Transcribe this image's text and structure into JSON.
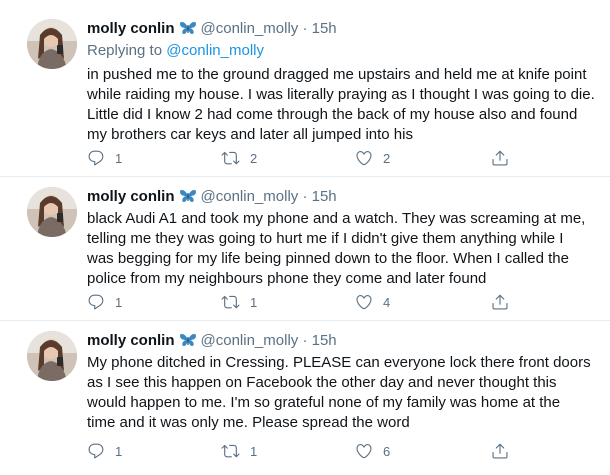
{
  "tweets": [
    {
      "name": "molly conlin",
      "handle": "@conlin_molly",
      "dot": "·",
      "time": "15h",
      "replying_prefix": "Replying to ",
      "replying_handle": "@conlin_molly",
      "lines": [
        "in pushed me to the ground dragged me upstairs and held me at knife point",
        "while raiding my house. I was literally praying as I thought I was going to die.",
        "Little did I know 2 had come through the back of my house also and found",
        "my brothers car keys and later all jumped into his"
      ],
      "reply_count": "1",
      "retweet_count": "2",
      "like_count": "2"
    },
    {
      "name": "molly conlin",
      "handle": "@conlin_molly",
      "dot": "·",
      "time": "15h",
      "lines": [
        "black Audi A1 and took my phone and a watch. They was screaming at me,",
        "telling me they was going to hurt me if I didn't give them anything while I",
        "was begging for my life being pinned down to the floor. When I called the",
        "police from my neighbours phone they come and later found"
      ],
      "reply_count": "1",
      "retweet_count": "1",
      "like_count": "4"
    },
    {
      "name": "molly conlin",
      "handle": "@conlin_molly",
      "dot": "·",
      "time": "15h",
      "lines": [
        "My phone ditched in Cressing. PLEASE can everyone lock there front doors",
        "as I see this happen on Facebook the other day and never thought this",
        "would happen to me. I'm so grateful none of my family was home at the",
        "time and it was only me. Please spread the word"
      ],
      "reply_count": "1",
      "retweet_count": "1",
      "like_count": "6"
    }
  ],
  "icons": {
    "verified_emoji": "butterfly-icon",
    "reply": "reply-icon",
    "retweet": "retweet-icon",
    "like": "heart-icon",
    "share": "share-icon"
  },
  "colors": {
    "link": "#1b95e0",
    "secondary_text": "#5b7083",
    "butterfly": "#3b88c3"
  }
}
